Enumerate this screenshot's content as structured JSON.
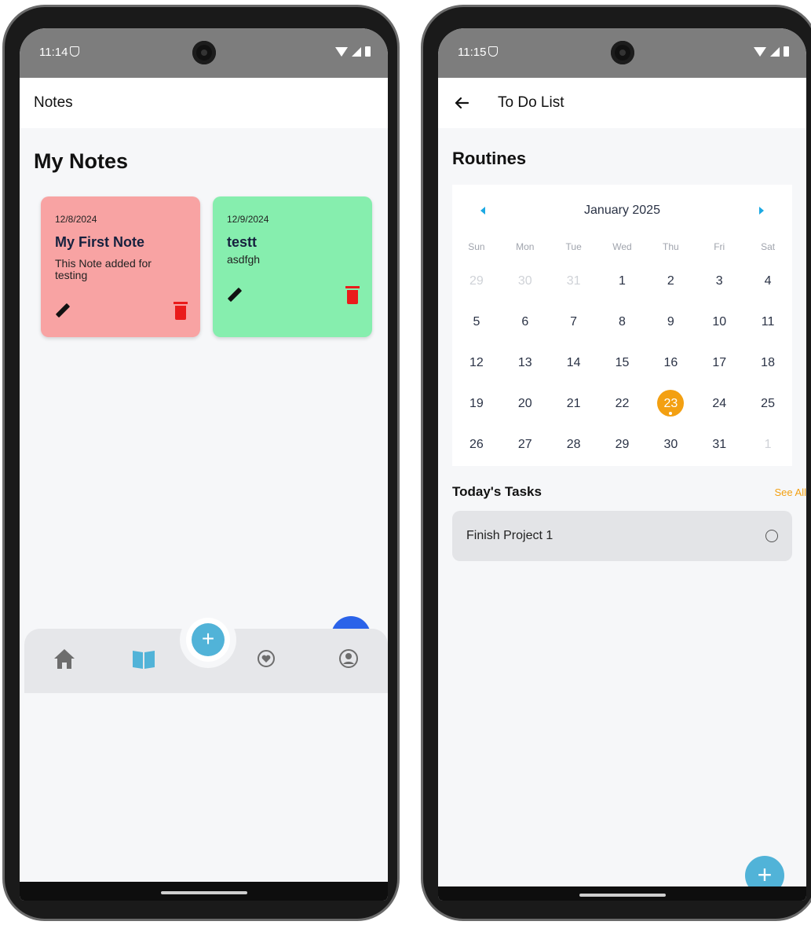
{
  "left_phone": {
    "status": {
      "time": "11:14"
    },
    "appbar_title": "Notes",
    "heading": "My Notes",
    "notes": [
      {
        "date": "12/8/2024",
        "title": "My First Note",
        "body": "This Note added for testing",
        "color": "#f8a3a3"
      },
      {
        "date": "12/9/2024",
        "title": "testt",
        "body": "asdfgh",
        "color": "#86eeae"
      }
    ],
    "nav": {
      "items": [
        "home-icon",
        "book-icon",
        "add-icon",
        "heart-icon",
        "profile-icon"
      ],
      "add_glyph": "+"
    },
    "colors": {
      "accent": "#51b3d8",
      "fab_peek": "#2b63e9",
      "delete": "#ea1b1b"
    }
  },
  "right_phone": {
    "status": {
      "time": "11:15"
    },
    "appbar_title": "To Do List",
    "heading": "Routines",
    "calendar": {
      "month_label": "January 2025",
      "weekdays": [
        "Sun",
        "Mon",
        "Tue",
        "Wed",
        "Thu",
        "Fri",
        "Sat"
      ],
      "weeks": [
        [
          "29",
          "30",
          "31",
          "1",
          "2",
          "3",
          "4"
        ],
        [
          "5",
          "6",
          "7",
          "8",
          "9",
          "10",
          "11"
        ],
        [
          "12",
          "13",
          "14",
          "15",
          "16",
          "17",
          "18"
        ],
        [
          "19",
          "20",
          "21",
          "22",
          "23",
          "24",
          "25"
        ],
        [
          "26",
          "27",
          "28",
          "29",
          "30",
          "31",
          "1"
        ]
      ],
      "selected_day": "23"
    },
    "tasks_title": "Today's Tasks",
    "see_all": "See All",
    "tasks": [
      {
        "label": "Finish Project 1",
        "done": false
      }
    ],
    "fab_glyph": "+",
    "colors": {
      "accent": "#f3a012",
      "fab": "#51b3d8"
    }
  }
}
